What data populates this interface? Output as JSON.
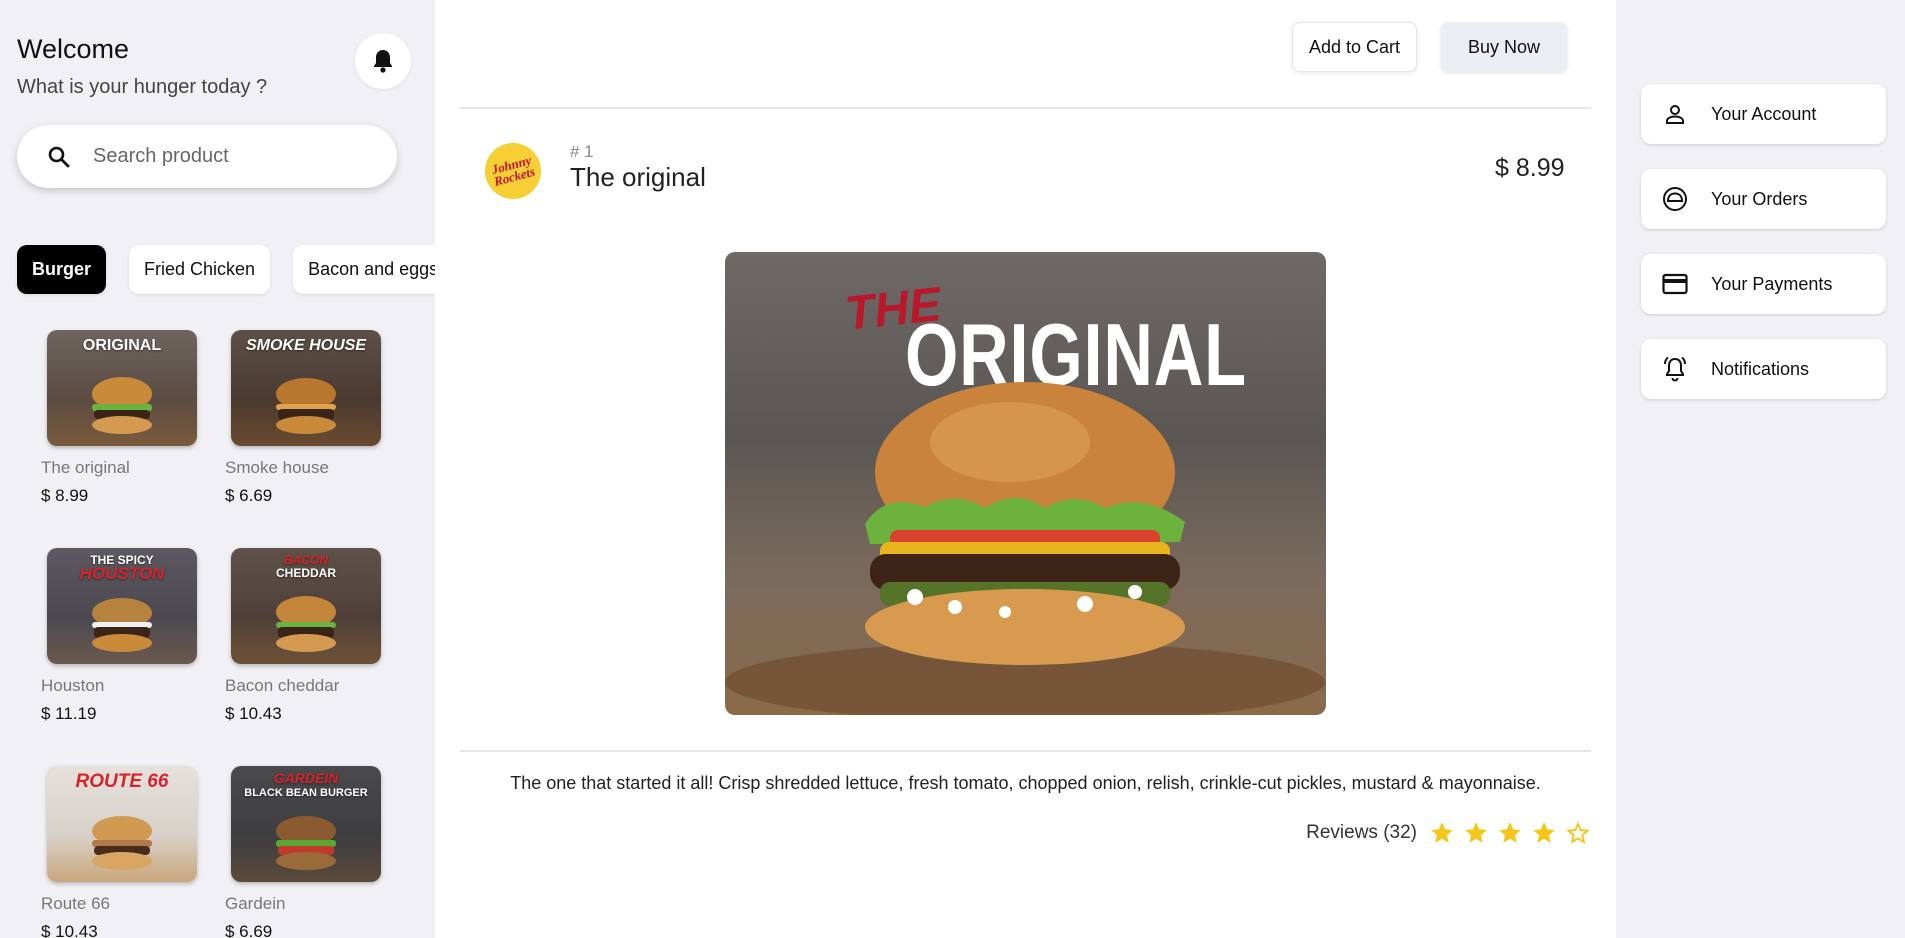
{
  "header": {
    "welcome": "Welcome",
    "subtitle": "What is your hunger today ?",
    "search_placeholder": "Search product"
  },
  "categories": [
    {
      "label": "Burger",
      "active": true
    },
    {
      "label": "Fried Chicken",
      "active": false
    },
    {
      "label": "Bacon and eggs",
      "active": false
    }
  ],
  "products": [
    {
      "name": "The original",
      "price": "$ 8.99",
      "thumb_title": "ORIGINAL",
      "thumb_pre": "THE",
      "bg": "#6b5a4e"
    },
    {
      "name": "Smoke house",
      "price": "$ 6.69",
      "thumb_title": "SMOKE HOUSE",
      "thumb_pre": "",
      "bg": "#5b4a3d"
    },
    {
      "name": "Houston",
      "price": "$ 11.19",
      "thumb_title": "HOUSTON",
      "thumb_pre": "THE SPICY",
      "bg": "#5a5560"
    },
    {
      "name": "Bacon cheddar",
      "price": "$ 10.43",
      "thumb_title": "CHEDDAR",
      "thumb_pre": "BACON",
      "bg": "#5f5045"
    },
    {
      "name": "Route 66",
      "price": "$ 10.43",
      "thumb_title": "ROUTE 66",
      "thumb_pre": "",
      "bg": "#d9d4cf"
    },
    {
      "name": "Gardein",
      "price": "$ 6.69",
      "thumb_title": "BLACK BEAN BURGER",
      "thumb_pre": "GARDEIN",
      "bg": "#4b4a4c"
    }
  ],
  "actions": {
    "add_to_cart": "Add to Cart",
    "buy_now": "Buy Now"
  },
  "detail": {
    "logo_text": "Johnny Rockets",
    "rank": "# 1",
    "title": "The original",
    "price": "$ 8.99",
    "hero_pre": "THE",
    "hero_title": "ORIGINAL",
    "description": "The one that started it all! Crisp shredded lettuce, fresh tomato, chopped onion, relish, crinkle-cut pickles, mustard & mayonnaise.",
    "reviews_label": "Reviews (32)",
    "rating": 4,
    "rating_max": 5,
    "star_color": "#f5c518"
  },
  "side_menu": [
    {
      "label": "Your Account",
      "icon": "person-icon"
    },
    {
      "label": "Your Orders",
      "icon": "orders-icon"
    },
    {
      "label": "Your Payments",
      "icon": "credit-card-icon"
    },
    {
      "label": "Notifications",
      "icon": "bell-ringing-icon"
    }
  ]
}
